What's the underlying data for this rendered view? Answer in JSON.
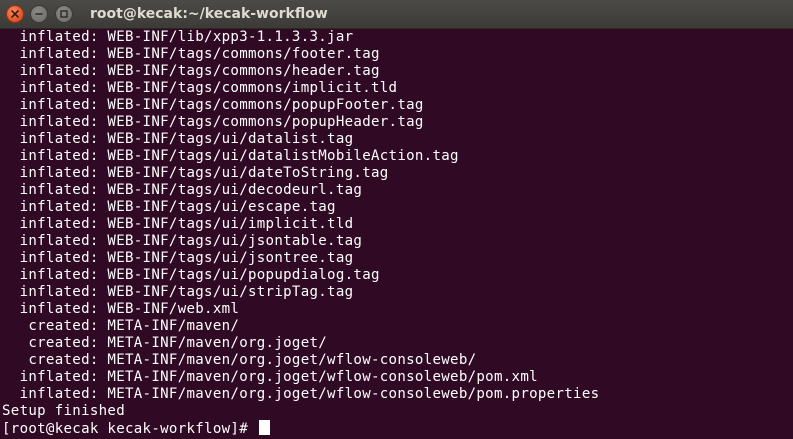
{
  "window": {
    "title": "root@kecak:~/kecak-workflow"
  },
  "terminal": {
    "lines": [
      "  inflated: WEB-INF/lib/xpp3-1.1.3.3.jar",
      "  inflated: WEB-INF/tags/commons/footer.tag",
      "  inflated: WEB-INF/tags/commons/header.tag",
      "  inflated: WEB-INF/tags/commons/implicit.tld",
      "  inflated: WEB-INF/tags/commons/popupFooter.tag",
      "  inflated: WEB-INF/tags/commons/popupHeader.tag",
      "  inflated: WEB-INF/tags/ui/datalist.tag",
      "  inflated: WEB-INF/tags/ui/datalistMobileAction.tag",
      "  inflated: WEB-INF/tags/ui/dateToString.tag",
      "  inflated: WEB-INF/tags/ui/decodeurl.tag",
      "  inflated: WEB-INF/tags/ui/escape.tag",
      "  inflated: WEB-INF/tags/ui/implicit.tld",
      "  inflated: WEB-INF/tags/ui/jsontable.tag",
      "  inflated: WEB-INF/tags/ui/jsontree.tag",
      "  inflated: WEB-INF/tags/ui/popupdialog.tag",
      "  inflated: WEB-INF/tags/ui/stripTag.tag",
      "  inflated: WEB-INF/web.xml",
      "   created: META-INF/maven/",
      "   created: META-INF/maven/org.joget/",
      "   created: META-INF/maven/org.joget/wflow-consoleweb/",
      "  inflated: META-INF/maven/org.joget/wflow-consoleweb/pom.xml",
      "  inflated: META-INF/maven/org.joget/wflow-consoleweb/pom.properties",
      "Setup finished"
    ],
    "prompt": "[root@kecak kecak-workflow]# "
  }
}
